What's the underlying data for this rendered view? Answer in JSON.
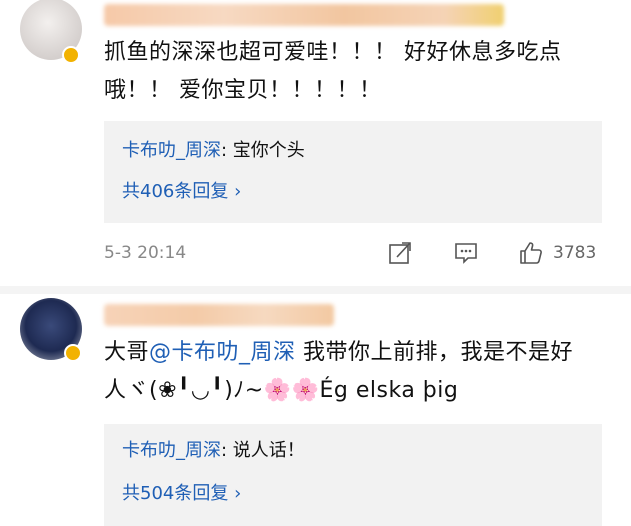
{
  "comments": [
    {
      "text": "抓鱼的深深也超可爱哇！！！ 好好休息多吃点哦！！ 爱你宝贝！！！！！",
      "reply": {
        "author": "卡布叻_周深",
        "text": ": 宝你个头"
      },
      "reply_count": "共406条回复 ›",
      "time": "5-3 20:14",
      "likes": "3783"
    },
    {
      "text_prefix": "大哥",
      "mention": "@卡布叻_周深",
      "text_suffix": " 我带你上前排，我是不是好人ヾ(❀╹◡╹)ﾉ~🌸🌸Ég elska þig",
      "reply": {
        "author": "卡布叻_周深",
        "text": ": 说人话！"
      },
      "reply_count": "共504条回复 ›"
    }
  ],
  "icons": [
    "share-icon",
    "comment-icon",
    "like-icon"
  ],
  "colors": {
    "link": "#1f5fb5",
    "reply_bg": "#f2f2f2",
    "meta": "#888888"
  }
}
